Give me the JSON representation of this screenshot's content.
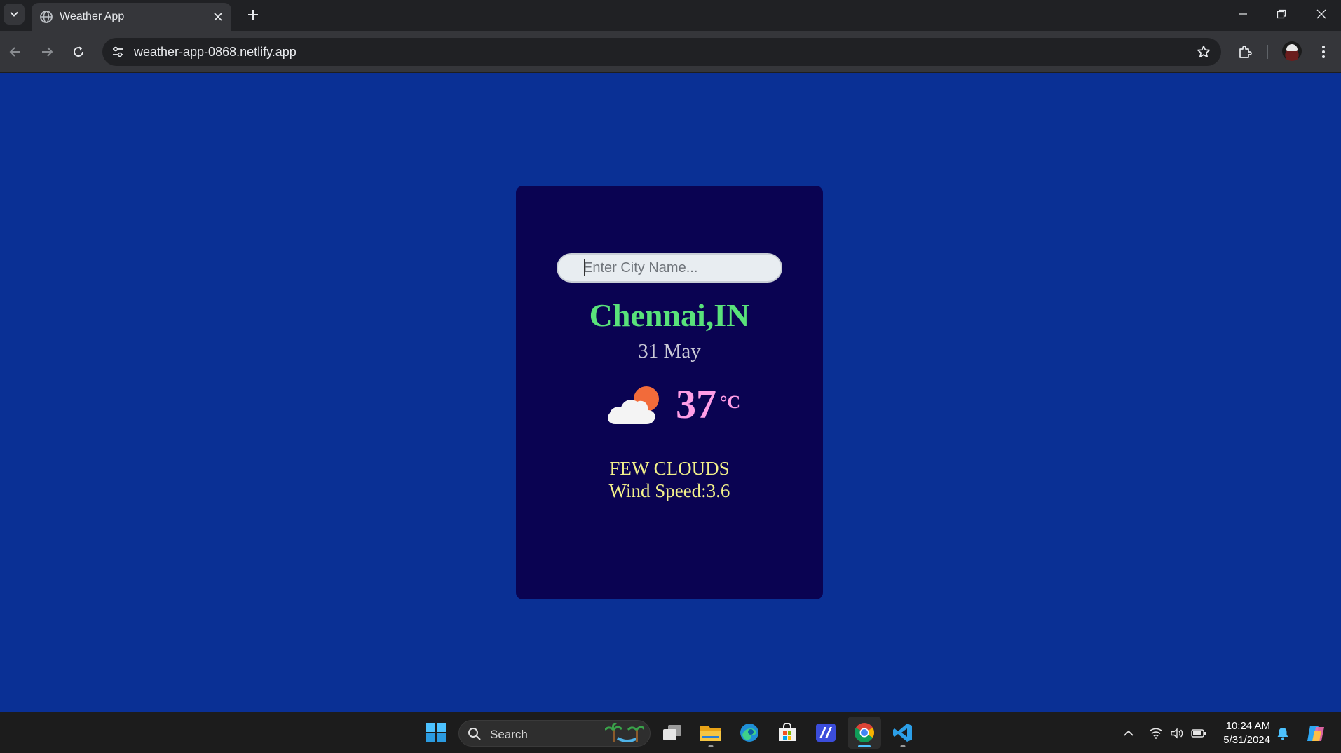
{
  "browser": {
    "tab": {
      "title": "Weather App"
    },
    "address_bar": {
      "url": "weather-app-0868.netlify.app"
    }
  },
  "weather_app": {
    "search": {
      "placeholder": "Enter City Name..."
    },
    "city": "Chennai,IN",
    "date": "31 May",
    "temperature": "37",
    "temperature_unit": "°C",
    "condition": "FEW CLOUDS",
    "wind_speed": "Wind Speed:3.6",
    "icon": "few-clouds-day-icon"
  },
  "colors": {
    "page_background": "#0a3095",
    "card_background": "#0a0352",
    "city_color": "#59e27a",
    "temperature_color": "#ff9ee6",
    "condition_color": "#f2f08a"
  },
  "taskbar": {
    "search_label": "Search",
    "apps": [
      "start-icon",
      "task-view-icon",
      "file-explorer-icon",
      "edge-icon",
      "microsoft-store-icon",
      "app-icon",
      "chrome-icon",
      "vscode-icon"
    ],
    "clock": {
      "time": "10:24 AM",
      "date": "5/31/2024"
    }
  }
}
